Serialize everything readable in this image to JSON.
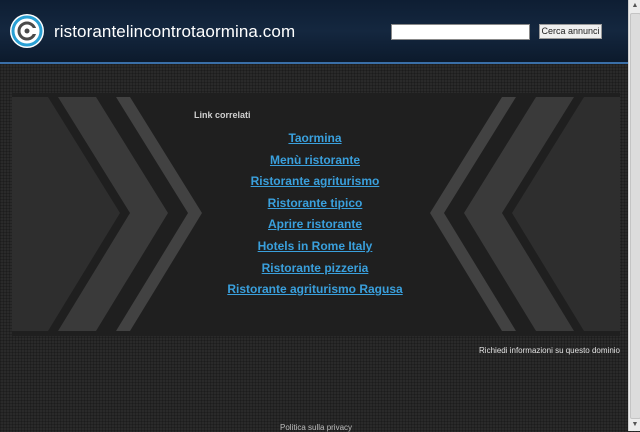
{
  "header": {
    "site_title": "ristorantelincontrotaormina.com",
    "logo_icon": "domain-logo-icon",
    "search": {
      "value": "",
      "placeholder": "",
      "button_label": "Cerca annunci"
    }
  },
  "related_links": {
    "heading": "Link correlati",
    "items": [
      "Taormina",
      "Menù ristorante",
      "Ristorante agriturismo",
      "Ristorante tipico",
      "Aprire ristorante",
      "Hotels in Rome Italy",
      "Ristorante pizzeria",
      "Ristorante agriturismo Ragusa"
    ]
  },
  "footer": {
    "request_info": "Richiedi informazioni su questo dominio",
    "privacy": "Politica sulla privacy"
  },
  "colors": {
    "header_bg": "#12233a",
    "header_border": "#3a6fa8",
    "link": "#3aa0dd",
    "panel": "#1f1f1f",
    "chevron": "#3a3a3a"
  }
}
